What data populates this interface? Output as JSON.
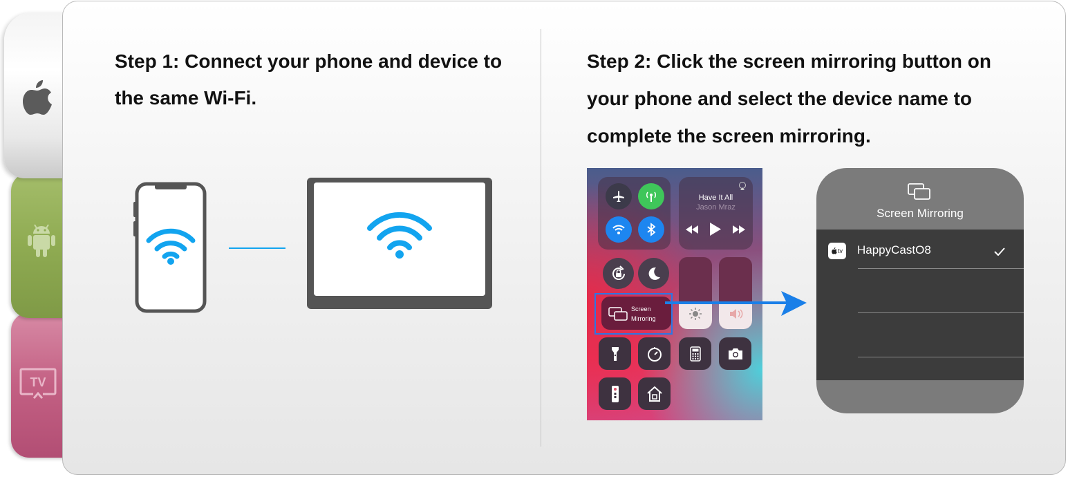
{
  "side_tabs": [
    {
      "name": "apple",
      "icon": "apple-icon"
    },
    {
      "name": "android",
      "icon": "android-icon"
    },
    {
      "name": "tv",
      "icon": "tv-icon",
      "label": "TV"
    }
  ],
  "step1": {
    "text": "Step 1: Connect your phone and device to the same Wi-Fi."
  },
  "step2": {
    "text": "Step 2: Click the screen mirroring button on your phone and select the device name to complete the screen mirroring."
  },
  "control_center": {
    "now_playing": {
      "title": "Have It All",
      "artist": "Jason Mraz"
    },
    "screen_mirroring": {
      "line1": "Screen",
      "line2": "Mirroring"
    }
  },
  "mirroring_menu": {
    "title": "Screen Mirroring",
    "device_badge": "tv",
    "device_name": "HappyCastO8",
    "checked": true
  },
  "colors": {
    "wifi": "#12a4ef",
    "accent_arrow": "#1a7fe8",
    "highlight_box": "#2a77e6"
  }
}
